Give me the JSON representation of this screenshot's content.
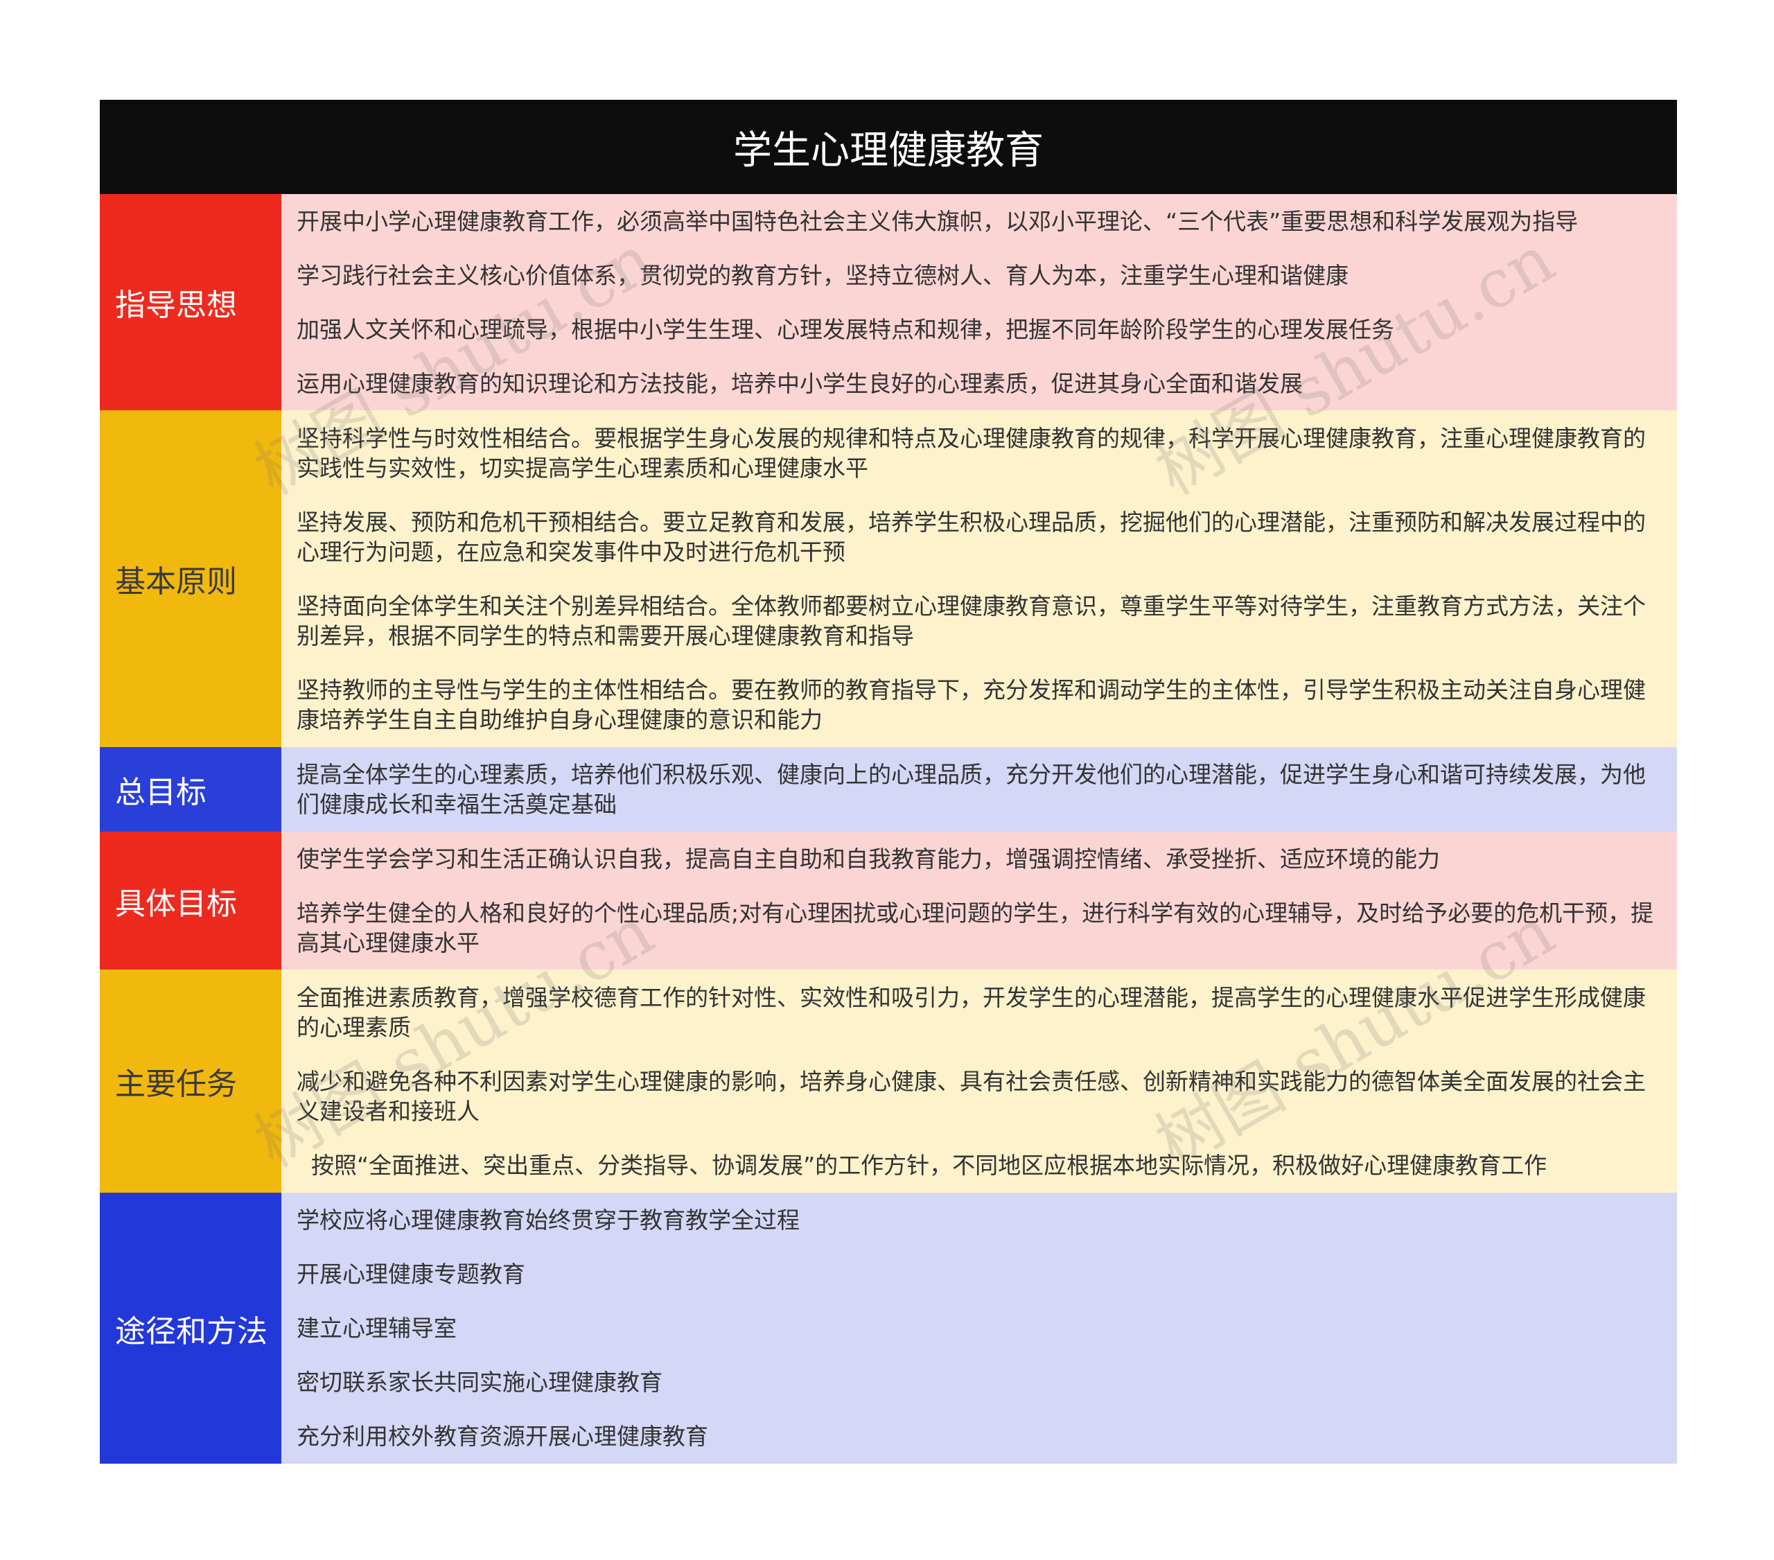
{
  "title": "学生心理健康教育",
  "colors": {
    "header_bg": "#0d0d0d",
    "red": "#ee2a1e",
    "yellow": "#f1b80d",
    "blue_dark": "#2a3fd8",
    "blue_medium": "#2338d9",
    "pink_bg": "#fbd5d4",
    "cream_bg": "#fdf2cc",
    "lavender_bg": "#d4d7f6"
  },
  "rows": [
    {
      "label": "指导思想",
      "label_color": "#ee2a1e",
      "bg": "#fbd5d4",
      "items": [
        "开展中小学心理健康教育工作，必须高举中国特色社会主义伟大旗帜，以邓小平理论、“三个代表”重要思想和科学发展观为指导",
        "学习践行社会主义核心价值体系，贯彻党的教育方针，坚持立德树人、育人为本，注重学生心理和谐健康",
        "加强人文关怀和心理疏导，根据中小学生生理、心理发展特点和规律，把握不同年龄阶段学生的心理发展任务",
        "运用心理健康教育的知识理论和方法技能，培养中小学生良好的心理素质，促进其身心全面和谐发展"
      ]
    },
    {
      "label": "基本原则",
      "label_color": "#f1b80d",
      "bg": "#fdf2cc",
      "items": [
        "坚持科学性与时效性相结合。要根据学生身心发展的规律和特点及心理健康教育的规律，科学开展心理健康教育，注重心理健康教育的实践性与实效性，切实提高学生心理素质和心理健康水平",
        "坚持发展、预防和危机干预相结合。要立足教育和发展，培养学生积极心理品质，挖掘他们的心理潜能，注重预防和解决发展过程中的心理行为问题，在应急和突发事件中及时进行危机干预",
        "坚持面向全体学生和关注个别差异相结合。全体教师都要树立心理健康教育意识，尊重学生平等对待学生，注重教育方式方法，关注个别差异，根据不同学生的特点和需要开展心理健康教育和指导",
        "坚持教师的主导性与学生的主体性相结合。要在教师的教育指导下，充分发挥和调动学生的主体性，引导学生积极主动关注自身心理健康培养学生自主自助维护自身心理健康的意识和能力"
      ]
    },
    {
      "label": "总目标",
      "label_color": "#2a3fd8",
      "bg": "#d4d7f6",
      "items": [
        "提高全体学生的心理素质，培养他们积极乐观、健康向上的心理品质，充分开发他们的心理潜能，促进学生身心和谐可持续发展，为他们健康成长和幸福生活奠定基础"
      ]
    },
    {
      "label": "具体目标",
      "label_color": "#ee2a1e",
      "bg": "#fbd5d4",
      "items": [
        "使学生学会学习和生活正确认识自我，提高自主自助和自我教育能力，增强调控情绪、承受挫折、适应环境的能力",
        "培养学生健全的人格和良好的个性心理品质;对有心理困扰或心理问题的学生，进行科学有效的心理辅导，及时给予必要的危机干预，提高其心理健康水平"
      ]
    },
    {
      "label": "主要任务",
      "label_color": "#f1b80d",
      "bg": "#fdf2cc",
      "items": [
        "全面推进素质教育，增强学校德育工作的针对性、实效性和吸引力，开发学生的心理潜能，提高学生的心理健康水平促进学生形成健康的心理素质",
        "减少和避免各种不利因素对学生心理健康的影响，培养身心健康、具有社会责任感、创新精神和实践能力的德智体美全面发展的社会主义建设者和接班人",
        "  按照“全面推进、突出重点、分类指导、协调发展”的工作方针，不同地区应根据本地实际情况，积极做好心理健康教育工作"
      ]
    },
    {
      "label": "途径和方法",
      "label_color": "#2338d9",
      "bg": "#d4d7f6",
      "items": [
        "学校应将心理健康教育始终贯穿于教育教学全过程",
        "开展心理健康专题教育",
        "建立心理辅导室",
        "密切联系家长共同实施心理健康教育",
        "充分利用校外教育资源开展心理健康教育"
      ]
    }
  ],
  "watermark": "树图 shutu.cn"
}
